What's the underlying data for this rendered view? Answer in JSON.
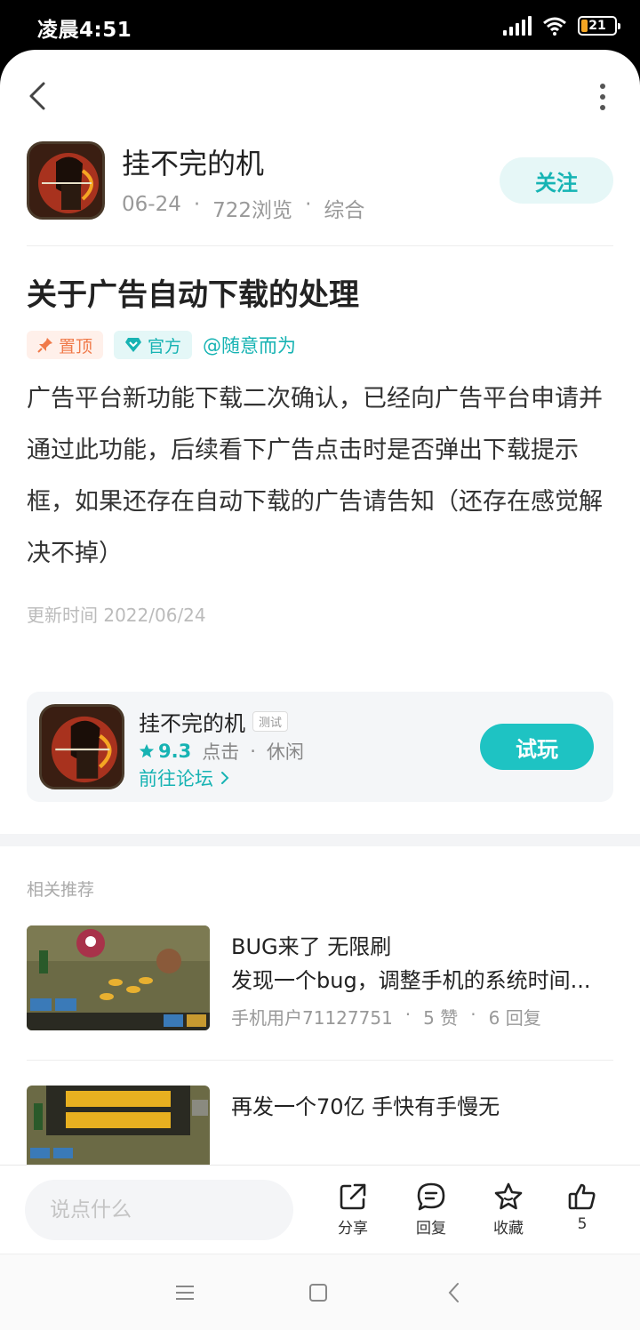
{
  "status_bar": {
    "time": "凌晨4:51",
    "battery": "21"
  },
  "author": {
    "name": "挂不完的机",
    "date": "06-24",
    "views": "722浏览",
    "category": "综合",
    "follow_label": "关注"
  },
  "post": {
    "title": "关于广告自动下载的处理",
    "tag_pinned": "置顶",
    "tag_official": "官方",
    "mention": "@随意而为",
    "body": "广告平台新功能下载二次确认，已经向广告平台申请并通过此功能，后续看下广告点击时是否弹出下载提示框，如果还存在自动下载的广告请告知（还存在感觉解决不掉）",
    "update_time": "更新时间 2022/06/24"
  },
  "game_card": {
    "name": "挂不完的机",
    "badge": "测试",
    "rating": "9.3",
    "genre1": "点击",
    "genre2": "休闲",
    "forum_link": "前往论坛",
    "trial_label": "试玩"
  },
  "recommendations": {
    "section_title": "相关推荐",
    "items": [
      {
        "title": "BUG来了 无限刷",
        "desc": "发现一个bug，调整手机的系统时间...",
        "author": "手机用户71127751",
        "likes": "5 赞",
        "replies": "6 回复"
      },
      {
        "title": "再发一个70亿 手快有手慢无"
      }
    ]
  },
  "bottom_bar": {
    "comment_placeholder": "说点什么",
    "share_label": "分享",
    "reply_label": "回复",
    "favorite_label": "收藏",
    "like_count": "5"
  },
  "colors": {
    "accent": "#1ec3c3",
    "pinned": "#f07a4a"
  }
}
